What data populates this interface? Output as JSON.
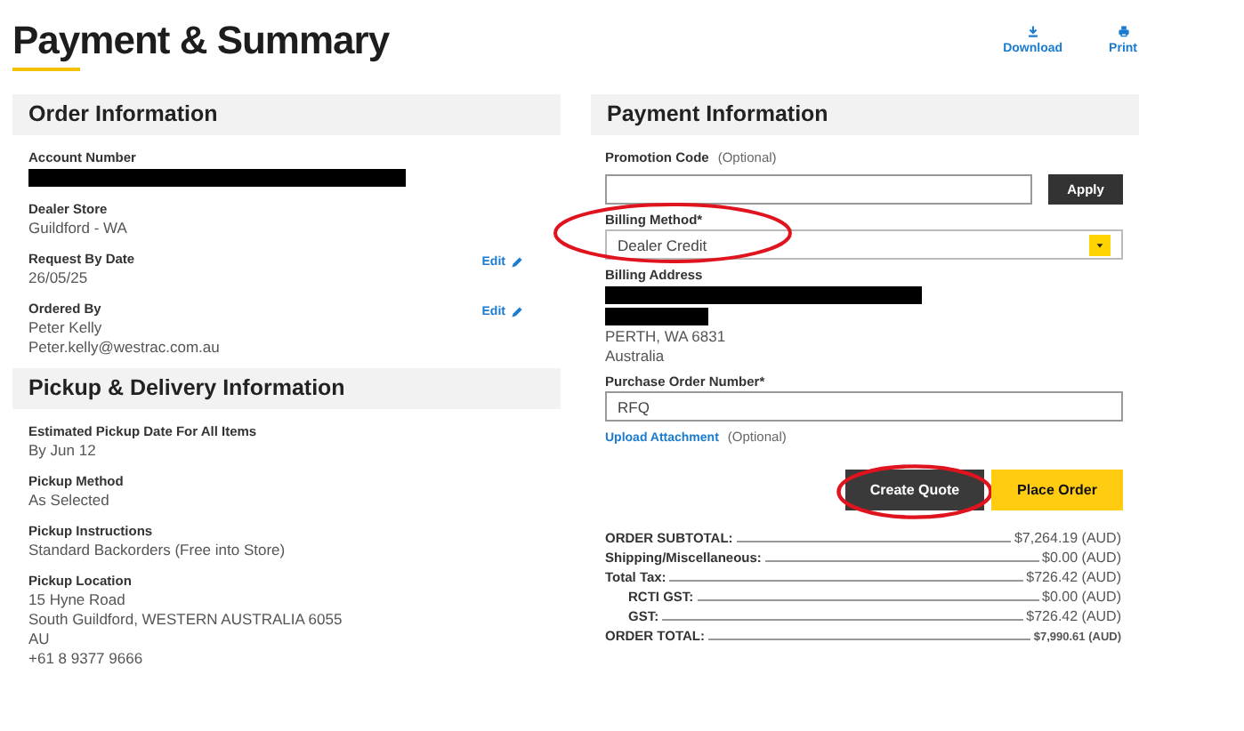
{
  "page_title": "Payment & Summary",
  "header_actions": [
    {
      "kind": "download",
      "label": "Download"
    },
    {
      "kind": "print",
      "label": "Print"
    }
  ],
  "order_information": {
    "title": "Order Information",
    "fields": [
      {
        "label": "Account Number",
        "lines": [
          {
            "kind": "redacted"
          }
        ]
      },
      {
        "label": "Dealer Store",
        "lines": [
          {
            "kind": "text",
            "text": "Guildford - WA"
          }
        ]
      },
      {
        "label": "Request By Date",
        "lines": [
          {
            "kind": "text",
            "text": "26/05/25"
          }
        ],
        "edit": "Edit"
      },
      {
        "label": "Ordered By",
        "lines": [
          {
            "kind": "text",
            "text": "Peter Kelly"
          },
          {
            "kind": "text",
            "text": "Peter.kelly@westrac.com.au"
          }
        ],
        "edit": "Edit"
      }
    ]
  },
  "pickup_delivery": {
    "title": "Pickup & Delivery Information",
    "fields": [
      {
        "label": "Estimated Pickup Date For All Items",
        "lines": [
          {
            "kind": "text",
            "text": "By Jun 12"
          }
        ]
      },
      {
        "label": "Pickup Method",
        "lines": [
          {
            "kind": "text",
            "text": "As Selected"
          }
        ]
      },
      {
        "label": "Pickup Instructions",
        "lines": [
          {
            "kind": "text",
            "text": "Standard Backorders (Free into Store)"
          }
        ]
      },
      {
        "label": "Pickup Location",
        "lines": [
          {
            "kind": "text",
            "text": "15 Hyne Road"
          },
          {
            "kind": "text",
            "text": "South Guildford, WESTERN AUSTRALIA 6055"
          },
          {
            "kind": "text",
            "text": "AU"
          },
          {
            "kind": "text",
            "text": "+61 8 9377 9666"
          }
        ]
      }
    ]
  },
  "payment_information": {
    "title": "Payment Information",
    "promotion_code": {
      "label": "Promotion Code",
      "hint": "(Optional)",
      "button": "Apply"
    },
    "billing_method": {
      "label": "Billing Method*",
      "value": "Dealer Credit",
      "highlighted": true
    },
    "billing_address": {
      "label": "Billing Address",
      "lines": [
        {
          "kind": "redacted"
        },
        {
          "kind": "redacted"
        },
        {
          "kind": "text",
          "text": "PERTH, WA 6831"
        },
        {
          "kind": "text",
          "text": "Australia"
        }
      ]
    },
    "purchase_order": {
      "label": "Purchase Order Number*",
      "value": "RFQ"
    },
    "upload": {
      "link": "Upload Attachment",
      "hint": "(Optional)"
    },
    "buttons": [
      {
        "kind": "secondary",
        "label": "Create Quote",
        "highlighted": true
      },
      {
        "kind": "primary",
        "label": "Place Order",
        "highlighted": false
      }
    ],
    "summary": [
      {
        "kind": "line",
        "label": "ORDER SUBTOTAL:",
        "value": "$7,264.19 (AUD)"
      },
      {
        "kind": "line",
        "label": "Shipping/Miscellaneous:",
        "value": "$0.00 (AUD)"
      },
      {
        "kind": "line",
        "label": "Total Tax:",
        "value": "$726.42 (AUD)"
      },
      {
        "kind": "subline",
        "label": "RCTI GST:",
        "value": "$0.00 (AUD)"
      },
      {
        "kind": "subline",
        "label": "GST:",
        "value": "$726.42 (AUD)"
      },
      {
        "kind": "total",
        "label": "ORDER TOTAL:",
        "value": "$7,990.61 (AUD)"
      }
    ]
  }
}
